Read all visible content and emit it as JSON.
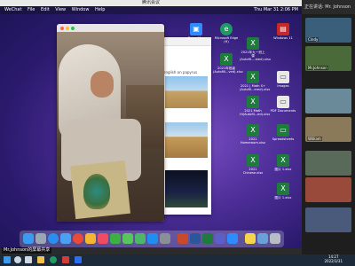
{
  "meeting": {
    "title": "腾讯会议"
  },
  "menubar": {
    "items": [
      "WeChat",
      "File",
      "Edit",
      "View",
      "Window",
      "Help"
    ],
    "clock": "Thu Mar 31 2:06 PM"
  },
  "browser": {
    "search_hint": "english on papyrus"
  },
  "desktop_icons": [
    {
      "label": "Zoom Mac",
      "color": "#2d8cff"
    },
    {
      "label": "Microsoft Edge (H)",
      "color": "#1e9b64"
    },
    {
      "label": "Windows 11",
      "color": "#c62828"
    },
    {
      "label": "2021年九一班上课 (Autofil....sted).xlsx",
      "color": "#1f7a3e"
    },
    {
      "label": "2021年班级 (Autofill...ved).xlsx",
      "color": "#1f7a3e"
    },
    {
      "label": "2021 | Math S+ (Autofil...ered).xlsx",
      "color": "#1f7a3e"
    },
    {
      "label": "Images",
      "color": "#e8e8e8"
    },
    {
      "label": "2021 Math Hi(Autofil...ed).xlsx",
      "color": "#1f7a3e"
    },
    {
      "label": "PDF Documents",
      "color": "#e8e8e8"
    },
    {
      "label": "2021 Homeroom.xlsx",
      "color": "#1f7a3e"
    },
    {
      "label": "Spreadsheets",
      "color": "#1f7a3e"
    },
    {
      "label": "2021 Chinese.xlsx",
      "color": "#1f7a3e"
    },
    {
      "label": "图片 1.xlsx",
      "color": "#1f7a3e"
    },
    {
      "label": "图片 1.xlsx",
      "color": "#1f7a3e"
    }
  ],
  "participants": {
    "header": "正在讲话: Mr. Johnson",
    "tiles": [
      {
        "name": "Cindy",
        "bg": "#3a5f7a"
      },
      {
        "name": "Mr.Johnson",
        "bg": "#4a6a3a"
      },
      {
        "name": "",
        "bg": "#6a8a9a"
      },
      {
        "name": "William",
        "bg": "#8a7a5a"
      },
      {
        "name": "",
        "bg": "#5a6a5a"
      },
      {
        "name": "",
        "bg": "#9a4a3a"
      },
      {
        "name": "",
        "bg": "#4a5a7a"
      }
    ]
  },
  "share_banner": "Mr.Johnson的屏幕共享",
  "taskbar": {
    "time": "14:27",
    "date": "2022/3/31"
  }
}
